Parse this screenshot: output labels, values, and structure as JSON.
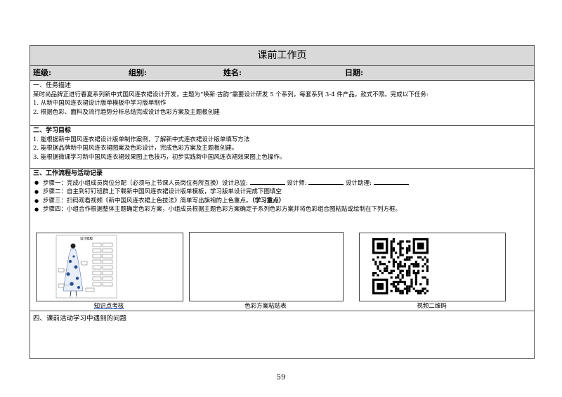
{
  "title": "课前工作页",
  "info": {
    "class": "班级:",
    "group": "组别:",
    "name": "姓名:",
    "date": "日期:"
  },
  "task": {
    "heading": "一、任务描述",
    "intro": "某时尚品牌正进行春夏系列新中式国风连衣裙设计开发，主题为“唤新·古韵”需要设计研发 5 个系列，每套系列 3-4 件产品，款式不限。完成以下任务:",
    "items": [
      "1. 从新中国风连衣裙设计版单模板中学习版单制作",
      "2. 根据色彩、面料及流行趋势分析总结完成设计色彩方案及主题板创建"
    ]
  },
  "goals": {
    "heading": "二、学习目标",
    "items": [
      "1.   能根据新中国风连衣裙设计版单制作案例，了解新中式连衣裙设计版单填写方法",
      "2.   能根据品牌新中国风连衣裙图案及色彩设计，完成色彩方案及主题板创建。",
      "3.   能根据微课学习新中国风连衣裙效果图上色技巧，初步实践新中国风连衣裙效果图上色操作。"
    ]
  },
  "flow": {
    "heading": "三、工作流程与活动记录",
    "step1": {
      "text": "步骤一：完成小组成员岗位分配（必须与上节课人员岗位有所互换）设计总监:",
      "designer": "设计师:",
      "assistant": "设计助理:"
    },
    "step2": "步骤二：自主到钉钉班群上下载新中国风连衣裙设计版单模板，学习版单设计完成下图填空",
    "step3": {
      "text": "步骤三：扫码观看视频《新中国风连衣裙上色技法》简单写出旗袍的上色重点。",
      "emph": "（学习重点）"
    },
    "step4": "步骤四：小组合作根据整体主题确定色彩方案，小组成员根据主题色彩方案确定子系列色彩方案并将色彩组合图粘贴或绘制在下列方框。",
    "sheet_title": "设计稿稿",
    "captions": [
      "知识点考核",
      "色彩方案粘贴表",
      "视频二维码"
    ]
  },
  "issues": {
    "heading": "四、课前活动学习中遇到的问题"
  },
  "page_number": "59"
}
